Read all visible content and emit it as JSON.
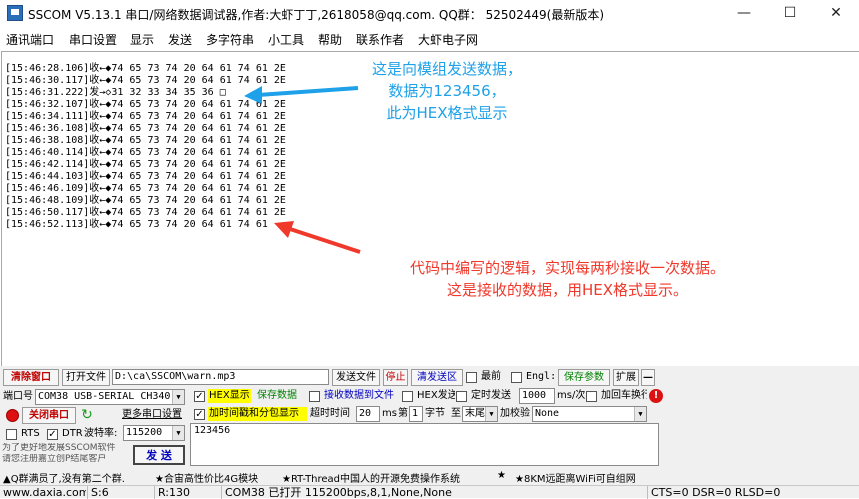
{
  "titlebar": {
    "title": "SSCOM V5.13.1 串口/网络数据调试器,作者:大虾丁丁,2618058@qq.com. QQ群： 52502449(最新版本)"
  },
  "menu": [
    "通讯端口",
    "串口设置",
    "显示",
    "发送",
    "多字符串",
    "小工具",
    "帮助",
    "联系作者",
    "大虾电子网"
  ],
  "log": [
    "[15:46:28.106]收←◆74 65 73 74 20 64 61 74 61 2E",
    "[15:46:30.117]收←◆74 65 73 74 20 64 61 74 61 2E",
    "[15:46:31.222]发→◇31 32 33 34 35 36 □",
    "[15:46:32.107]收←◆74 65 73 74 20 64 61 74 61 2E",
    "[15:46:34.111]收←◆74 65 73 74 20 64 61 74 61 2E",
    "[15:46:36.108]收←◆74 65 73 74 20 64 61 74 61 2E",
    "[15:46:38.108]收←◆74 65 73 74 20 64 61 74 61 2E",
    "[15:46:40.114]收←◆74 65 73 74 20 64 61 74 61 2E",
    "[15:46:42.114]收←◆74 65 73 74 20 64 61 74 61 2E",
    "[15:46:44.103]收←◆74 65 73 74 20 64 61 74 61 2E",
    "[15:46:46.109]收←◆74 65 73 74 20 64 61 74 61 2E",
    "[15:46:48.109]收←◆74 65 73 74 20 64 61 74 61 2E",
    "[15:46:50.117]收←◆74 65 73 74 20 64 61 74 61 2E",
    "[15:46:52.113]收←◆74 65 73 74 20 64 61 74 61"
  ],
  "annotations": {
    "send_note": [
      "这是向模组发送数据，",
      "数据为123456，",
      "此为HEX格式显示"
    ],
    "recv_note": [
      "代码中编写的逻辑，实现每两秒接收一次数据。",
      "这是接收的数据，用HEX格式显示。"
    ],
    "blue": "#1ea1e8",
    "red": "#f0382b"
  },
  "toolbar": {
    "clear_window": "清除窗口",
    "open_file": "打开文件",
    "file_path": "D:\\ca\\SSCOM\\warn.mp3",
    "send_file": "发送文件",
    "stop": "停止",
    "clear_send": "清发送区",
    "topmost": "最前",
    "english": "Engl:",
    "save_params": "保存参数",
    "expand": "扩展",
    "collapse": "—"
  },
  "port": {
    "port_label": "端口号",
    "port_value": "COM38 USB-SERIAL CH340",
    "close_port": "关闭串口",
    "more_settings": "更多串口设置",
    "rts": "RTS",
    "dtr": "DTR",
    "baud_label": "波特率:",
    "baud_value": "115200"
  },
  "options": {
    "hex_display": "HEX显示",
    "save_data": "保存数据",
    "recv_to_file": "接收数据到文件",
    "hex_send": "HEX发送",
    "timed_send": "定时发送",
    "interval_value": "1000",
    "interval_unit": "ms/次",
    "add_crlf": "加回车换行",
    "add_timestamp": "加时间戳和分包显示",
    "timeout_label": "超时时间",
    "timeout_value": "20",
    "timeout_unit": "ms",
    "byte_no_label": "第",
    "byte_no_value": "1",
    "byte_unit": "字节",
    "to_label": "至",
    "to_value": "末尾",
    "checksum_label": "加校验",
    "checksum_value": "None"
  },
  "send": {
    "text": "123456",
    "send_button": "发 送"
  },
  "promo": {
    "line1": "为了更好地发展SSCOM软件",
    "line2": "请您注册嘉立创P结尾客户"
  },
  "ad_bar": {
    "item1": "▲Q群满员了,没有第二个群.",
    "item2": "★合宙高性价比4G模块",
    "item3": "★RT-Thread中国人的开源免费操作系统",
    "item4": "★",
    "item5": "★8KM远距离WiFi可自组网"
  },
  "statusbar": {
    "site": "www.daxia.com",
    "s": "S:6",
    "r": "R:130",
    "port_status": "COM38 已打开  115200bps,8,1,None,None",
    "signals": "CTS=0 DSR=0 RLSD=0"
  }
}
